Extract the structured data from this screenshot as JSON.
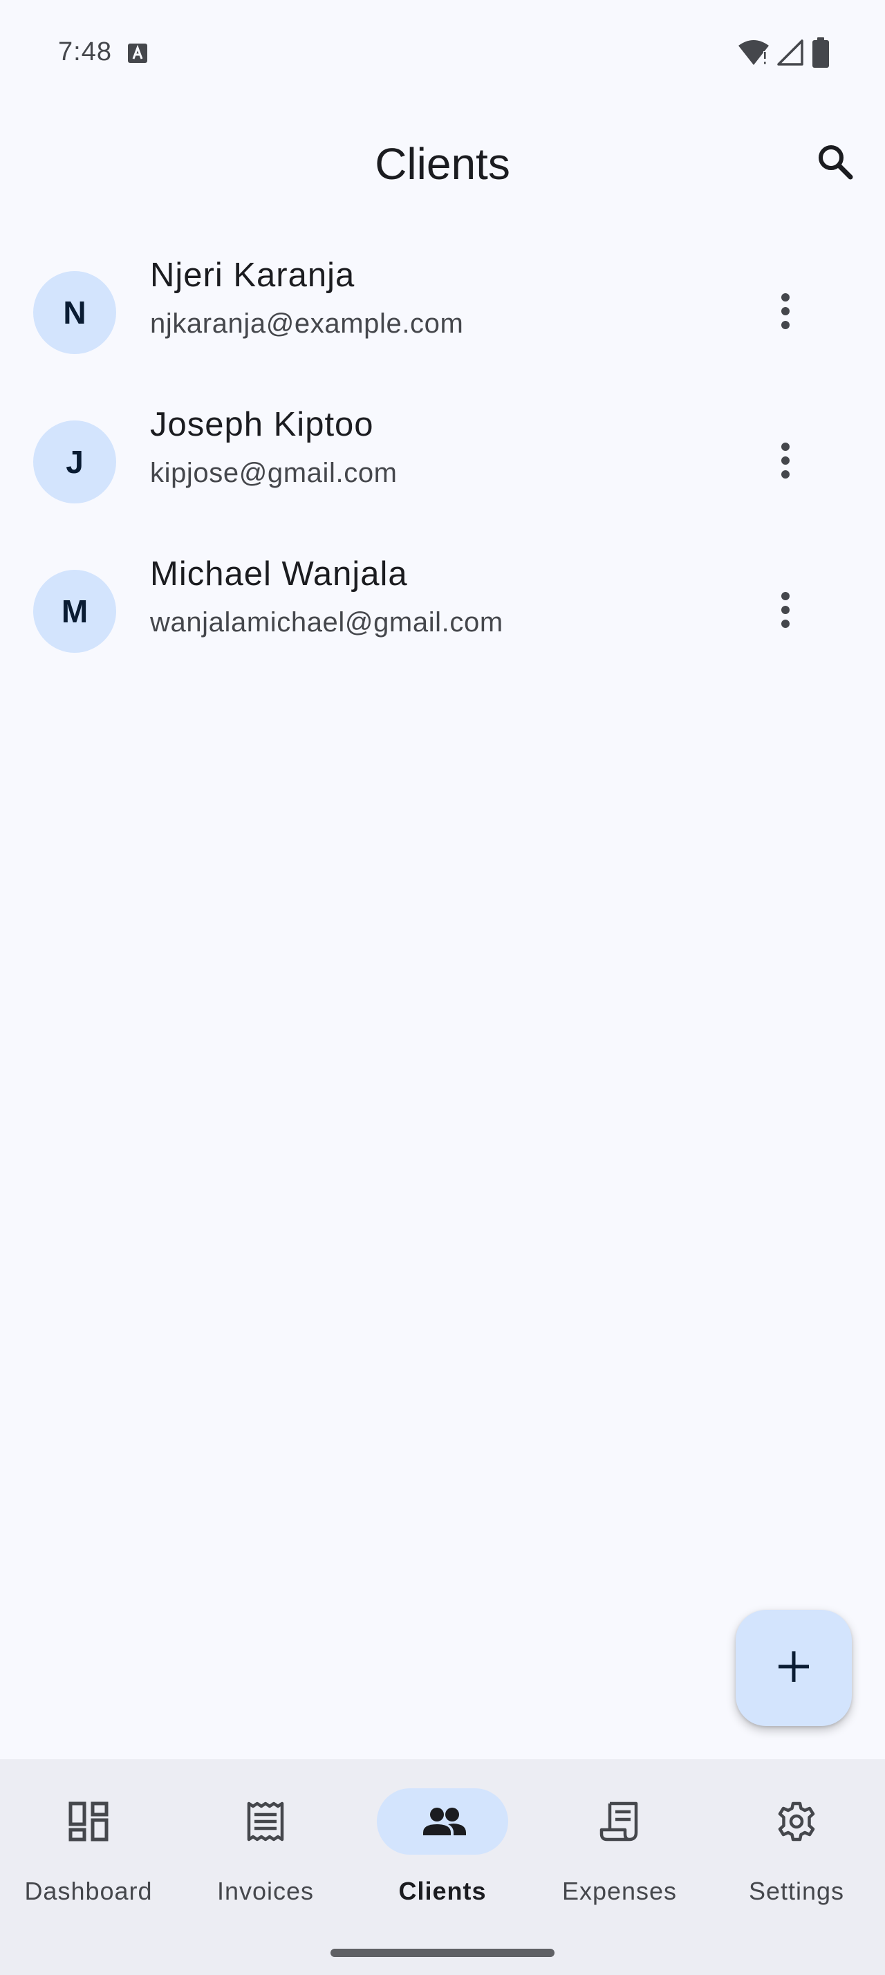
{
  "status_bar": {
    "time": "7:48",
    "icons": [
      "keyboard-a-icon",
      "wifi-alert-icon",
      "cell-signal-icon",
      "battery-icon"
    ]
  },
  "app_bar": {
    "title": "Clients",
    "search_icon": "search-icon"
  },
  "clients": [
    {
      "initial": "N",
      "name": "Njeri Karanja",
      "email": "njkaranja@example.com"
    },
    {
      "initial": "J",
      "name": "Joseph Kiptoo",
      "email": "kipjose@gmail.com"
    },
    {
      "initial": "M",
      "name": "Michael Wanjala",
      "email": "wanjalamichael@gmail.com"
    }
  ],
  "fab": {
    "icon": "plus-icon"
  },
  "bottom_nav": {
    "active": "Clients",
    "items": [
      {
        "label": "Dashboard",
        "icon": "dashboard-icon"
      },
      {
        "label": "Invoices",
        "icon": "invoice-icon"
      },
      {
        "label": "Clients",
        "icon": "people-icon"
      },
      {
        "label": "Expenses",
        "icon": "receipt-icon"
      },
      {
        "label": "Settings",
        "icon": "gear-icon"
      }
    ]
  },
  "colors": {
    "background": "#f8f9fe",
    "accent_container": "#d3e4fd",
    "nav_background": "#ecedf3",
    "on_surface": "#1b1c20",
    "on_surface_variant": "#45474c"
  }
}
